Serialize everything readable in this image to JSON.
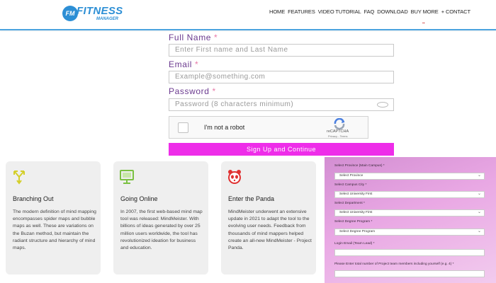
{
  "header": {
    "logo_badge": "FM",
    "logo_name": "FITNESS",
    "logo_sub": "MANAGER",
    "nav": [
      "HOME",
      "FEATURES",
      "VIDEO TUTORIAL",
      "FAQ",
      "DOWNLOAD",
      "BUY MORE",
      "+ CONTACT"
    ],
    "language_flags": "▪▪"
  },
  "form": {
    "full_name_label": "Full Name",
    "full_name_placeholder": "Enter First name and Last Name",
    "email_label": "Email",
    "email_placeholder": "Example@something.com",
    "password_label": "Password",
    "password_placeholder": "Password (8 characters minimum)",
    "required_mark": "*",
    "captcha_text": "I'm not a robot",
    "captcha_brand": "reCAPTCHA",
    "captcha_terms": "Privacy - Terms",
    "submit_label": "Sign Up and Continue"
  },
  "cards": [
    {
      "icon": "arrows-merge-icon",
      "title": "Branching Out",
      "text": "The modern definition of mind mapping encompasses spider maps and bubble maps as well. These are variations on the Buzan method, but maintain the radiant structure and hierarchy of mind maps."
    },
    {
      "icon": "monitor-icon",
      "title": "Going Online",
      "text": "In 2007, the first web-based mind map tool was released: MindMeister. With billions of ideas generated by over 25 million users worldwide, the tool has revolutionized ideation for business and education."
    },
    {
      "icon": "panda-icon",
      "title": "Enter the Panda",
      "text": "MindMeister underwent an extensive update in 2021 to adapt the tool to the evolving user needs. Feedback from thousands of mind mappers helped create an all-new MindMeister - Project Panda."
    }
  ],
  "panel": {
    "fields": [
      {
        "label": "Select Province (Main Campus) *",
        "value": "Select Province"
      },
      {
        "label": "Select Campus City *",
        "value": "Select University First"
      },
      {
        "label": "Select Department *",
        "value": "Select University First"
      },
      {
        "label": "Select Degree Program *",
        "value": "Select Degree Program"
      }
    ],
    "email_label": "Login Email (Team Lead) *",
    "members_label": "Please Enter total number of Project team members including yourself (e.g. 4) *"
  },
  "colors": {
    "brand_blue": "#2d8fd5",
    "label_purple": "#6b3a8f",
    "button_magenta": "#ee2de9",
    "panel_pink": "#e9a8e4"
  }
}
